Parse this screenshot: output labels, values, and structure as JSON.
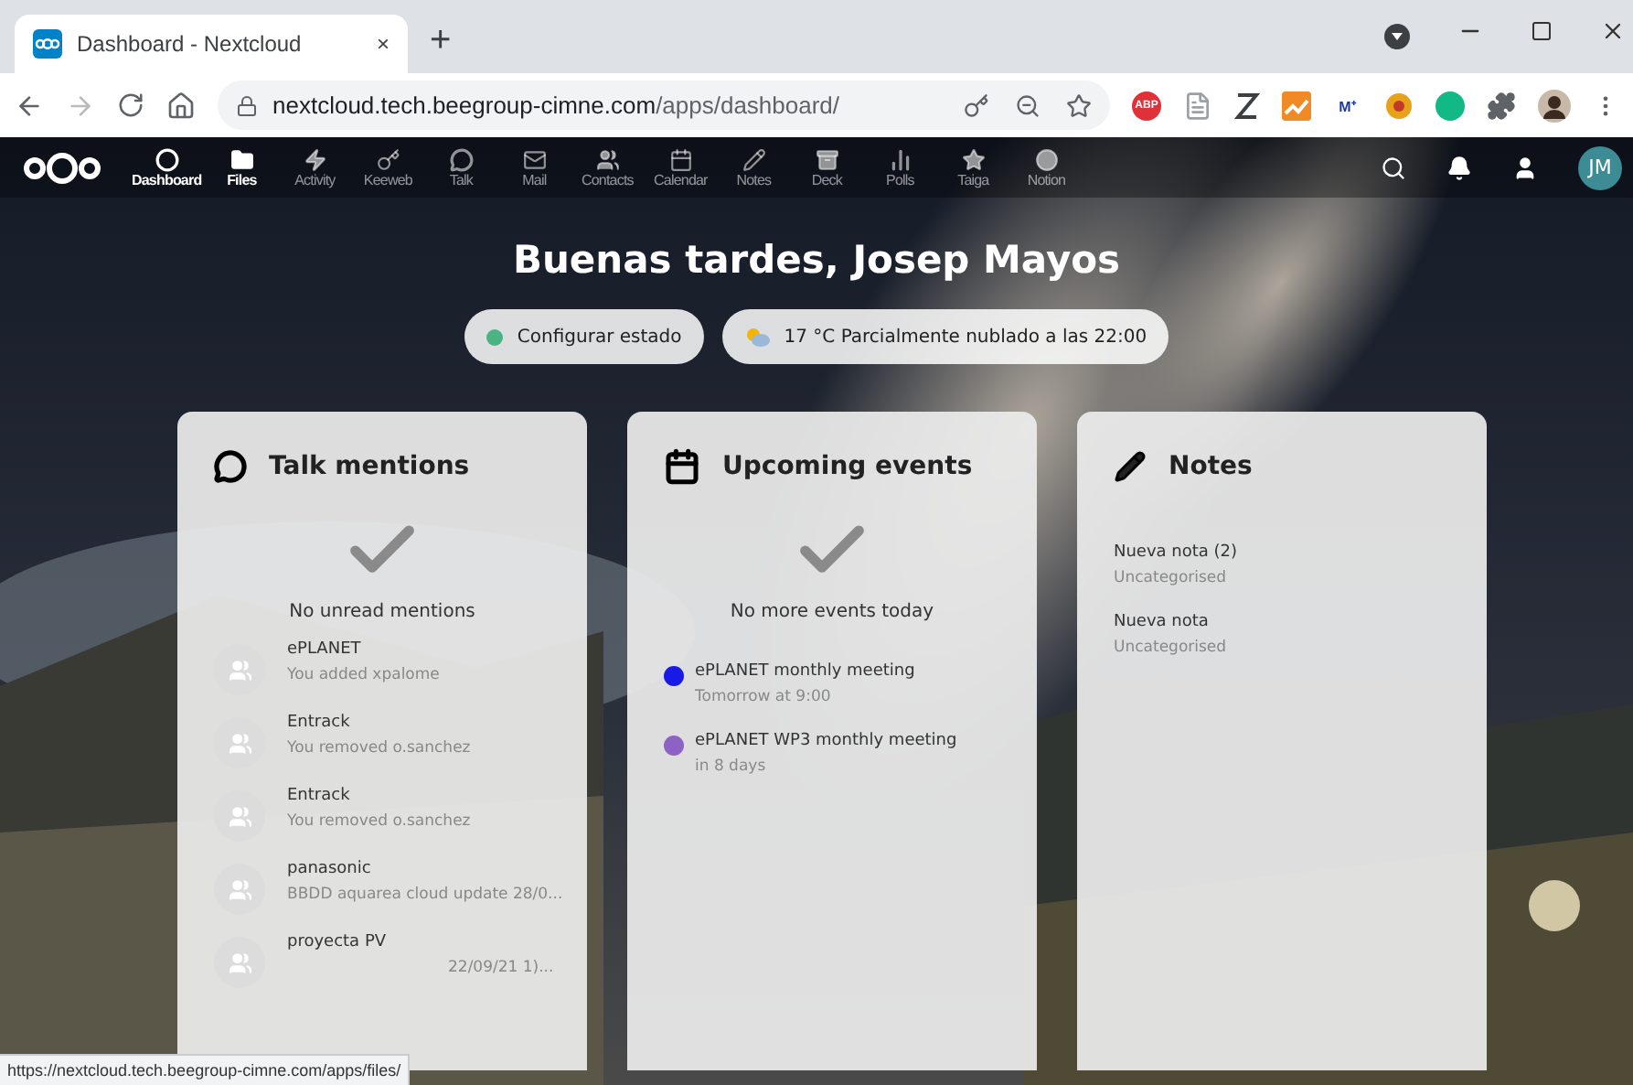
{
  "browser": {
    "tab": {
      "title": "Dashboard - Nextcloud",
      "close": "×"
    },
    "new_tab": "+",
    "url_host": "nextcloud.tech.beegroup-cimne.com",
    "url_path": "/apps/dashboard/",
    "extensions": [
      {
        "kind": "abp",
        "label": "ABP"
      },
      {
        "kind": "doc"
      },
      {
        "kind": "loop"
      },
      {
        "kind": "chart"
      },
      {
        "kind": "small",
        "label": "M⁺"
      },
      {
        "kind": "flower"
      },
      {
        "kind": "circle"
      },
      {
        "kind": "puzzle"
      }
    ]
  },
  "header": {
    "apps": [
      {
        "label": "Dashboard",
        "highlighted": true
      },
      {
        "label": "Files",
        "highlighted": true
      },
      {
        "label": "Activity",
        "highlighted": false
      },
      {
        "label": "Keeweb",
        "highlighted": false
      },
      {
        "label": "Talk",
        "highlighted": false
      },
      {
        "label": "Mail",
        "highlighted": false
      },
      {
        "label": "Contacts",
        "highlighted": false
      },
      {
        "label": "Calendar",
        "highlighted": false
      },
      {
        "label": "Notes",
        "highlighted": false
      },
      {
        "label": "Deck",
        "highlighted": false
      },
      {
        "label": "Polls",
        "highlighted": false
      },
      {
        "label": "Taiga",
        "highlighted": false
      },
      {
        "label": "Notion",
        "highlighted": false
      }
    ],
    "avatar": "JM"
  },
  "greeting": "Buenas tardes, Josep Mayos",
  "status_button": "Configurar estado",
  "weather_button": "17 °C Parcialmente nublado a las 22:00",
  "widgets": [
    {
      "kind": "talk",
      "title": "Talk mentions",
      "empty_message": "No unread mentions",
      "items": [
        {
          "title": "ePLANET",
          "subtitle": "You added xpalome"
        },
        {
          "title": "Entrack",
          "subtitle": "You removed o.sanchez"
        },
        {
          "title": "Entrack",
          "subtitle": "You removed o.sanchez"
        },
        {
          "title": "panasonic",
          "subtitle": "BBDD aquarea cloud update 28/0..."
        },
        {
          "title": "proyecta PV",
          "subtitle": "22/09/21 1)..."
        }
      ]
    },
    {
      "kind": "events",
      "title": "Upcoming events",
      "empty_message": "No more events today",
      "items": [
        {
          "title": "ePLANET monthly meeting",
          "subtitle": "Tomorrow at 9:00",
          "color": "#1a1ae6"
        },
        {
          "title": "ePLANET WP3 monthly meeting",
          "subtitle": "in 8 days",
          "color": "#8e62c4"
        }
      ]
    },
    {
      "kind": "notes",
      "title": "Notes",
      "items": [
        {
          "title": "Nueva nota (2)",
          "subtitle": "Uncategorised"
        },
        {
          "title": "Nueva nota",
          "subtitle": "Uncategorised"
        }
      ]
    }
  ],
  "status_bar": "https://nextcloud.tech.beegroup-cimne.com/apps/files/"
}
